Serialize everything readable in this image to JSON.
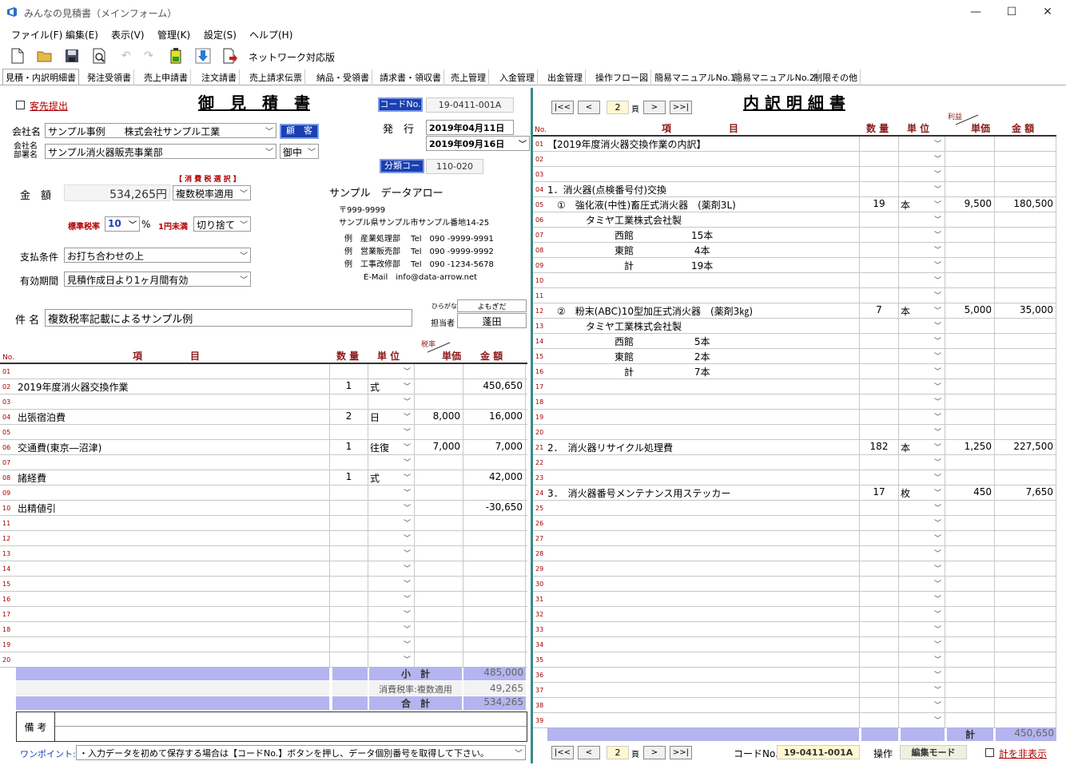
{
  "window": {
    "title": "みんなの見積書（メインフォーム）",
    "minimize": "—",
    "maximize": "☐",
    "close": "✕"
  },
  "menu": [
    "ファイル(F)",
    "編集(E)",
    "表示(V)",
    "管理(K)",
    "設定(S)",
    "ヘルプ(H)"
  ],
  "toolbar": {
    "network_label": "ネットワーク対応版"
  },
  "tabs": [
    "見積・内訳明細書",
    "発注受領書",
    "売上申請書",
    "注文請書",
    "売上請求伝票",
    "納品・受領書",
    "請求書・領収書",
    "売上管理",
    "入金管理",
    "出金管理",
    "操作フロー図",
    "簡易マニュアルNo.1",
    "簡易マニュアルNo.2",
    "制限その他"
  ],
  "left": {
    "send_label": "客先提出",
    "doc_title": "御　見　積　書",
    "code_btn": "コードNo.",
    "code_value": "19-0411-001A",
    "company_label": "会社名",
    "company_value": "サンプル事例　　株式会社サンプル工業",
    "customer_btn": "顧　客",
    "dept_label1": "会社名",
    "dept_label2": "部署名",
    "dept_value": "サンプル消火器販売事業部",
    "honorific": "御中",
    "issue_label": "発　行　日",
    "issue_date": "2019年04月11日",
    "date2": "2019年09月16日",
    "class_btn": "分類コード",
    "class_value": "110-020",
    "tax_select_label": "【 消 費 税 選 択 】",
    "tax_mode": "複数税率適用",
    "amount_label": "金　額",
    "amount_value": "534,265円",
    "std_rate_label": "標準税率",
    "std_rate": "10",
    "pct": "%",
    "rounding_label": "1円未満",
    "rounding": "切り捨て",
    "pay_label": "支払条件",
    "pay_value": "お打ち合わせの上",
    "valid_label": "有効期間",
    "valid_value": "見積作成日より1ヶ月間有効",
    "subject_label": "件 名",
    "subject_value": "複数税率記載によるサンプル例",
    "company_name": "サンプル　データアロー",
    "postal": "〒999-9999",
    "address": "サンプル県サンプル市サンプル番地14-25",
    "contacts": [
      "例　産業処理部　 Tel　090 -9999-9991",
      "例　営業販売部　 Tel　090 -9999-9992",
      "例　工事改修部　 Tel　090 -1234-5678"
    ],
    "email": "E-Mail　info@data-arrow.net",
    "hiragana_label": "ひらがな",
    "hiragana_value": "よもぎだ",
    "person_label": "担当者",
    "person_value": "蓬田",
    "col_no": "No.",
    "col_item": "項　　　　　目",
    "col_qty": "数 量",
    "col_unit": "単 位",
    "col_taxrate": "税率",
    "col_price": "単価",
    "col_amount": "金 額",
    "rows": [
      {
        "n": "01",
        "item": "",
        "qty": "",
        "unit": "",
        "price": "",
        "amount": ""
      },
      {
        "n": "02",
        "item": "2019年度消火器交換作業",
        "qty": "1",
        "unit": "式",
        "price": "",
        "amount": "450,650"
      },
      {
        "n": "03",
        "item": "",
        "qty": "",
        "unit": "",
        "price": "",
        "amount": ""
      },
      {
        "n": "04",
        "item": "出張宿泊費",
        "qty": "2",
        "unit": "日",
        "price": "8,000",
        "amount": "16,000"
      },
      {
        "n": "05",
        "item": "",
        "qty": "",
        "unit": "",
        "price": "",
        "amount": ""
      },
      {
        "n": "06",
        "item": "交通費(東京―沼津)",
        "qty": "1",
        "unit": "往復",
        "price": "7,000",
        "amount": "7,000"
      },
      {
        "n": "07",
        "item": "",
        "qty": "",
        "unit": "",
        "price": "",
        "amount": ""
      },
      {
        "n": "08",
        "item": "諸経費",
        "qty": "1",
        "unit": "式",
        "price": "",
        "amount": "42,000"
      },
      {
        "n": "09",
        "item": "",
        "qty": "",
        "unit": "",
        "price": "",
        "amount": ""
      },
      {
        "n": "10",
        "item": "出精値引",
        "qty": "",
        "unit": "",
        "price": "",
        "amount": "-30,650"
      },
      {
        "n": "11",
        "item": "",
        "qty": "",
        "unit": "",
        "price": "",
        "amount": ""
      },
      {
        "n": "12",
        "item": "",
        "qty": "",
        "unit": "",
        "price": "",
        "amount": ""
      },
      {
        "n": "13",
        "item": "",
        "qty": "",
        "unit": "",
        "price": "",
        "amount": ""
      },
      {
        "n": "14",
        "item": "",
        "qty": "",
        "unit": "",
        "price": "",
        "amount": ""
      },
      {
        "n": "15",
        "item": "",
        "qty": "",
        "unit": "",
        "price": "",
        "amount": ""
      },
      {
        "n": "16",
        "item": "",
        "qty": "",
        "unit": "",
        "price": "",
        "amount": ""
      },
      {
        "n": "17",
        "item": "",
        "qty": "",
        "unit": "",
        "price": "",
        "amount": ""
      },
      {
        "n": "18",
        "item": "",
        "qty": "",
        "unit": "",
        "price": "",
        "amount": ""
      },
      {
        "n": "19",
        "item": "",
        "qty": "",
        "unit": "",
        "price": "",
        "amount": ""
      },
      {
        "n": "20",
        "item": "",
        "qty": "",
        "unit": "",
        "price": "",
        "amount": ""
      }
    ],
    "subtotal_label": "小　計",
    "subtotal": "485,000",
    "tax_label": "消費税率:複数適用",
    "tax": "49,265",
    "total_label": "合　計",
    "total": "534,265",
    "remarks_label": "備 考",
    "remarks": "",
    "tip_label": "ワンポイント:",
    "tip": "・入力データを初めて保存する場合は【コードNo.】ボタンを押し、データ個別番号を取得して下さい。"
  },
  "right": {
    "page": "2",
    "page_suffix": "頁",
    "nav": [
      "|<<",
      "<",
      ">",
      ">>|"
    ],
    "doc_title": "内 訳 明 細 書",
    "col_no": "No.",
    "col_item": "項　　　　　　目",
    "col_qty": "数 量",
    "col_unit": "単 位",
    "col_profit": "利益",
    "col_price": "単価",
    "col_amount": "金 額",
    "rows": [
      {
        "n": "01",
        "item": "【2019年度消火器交換作業の内訳】",
        "qty": "",
        "unit": "",
        "price": "",
        "amount": ""
      },
      {
        "n": "02",
        "item": "",
        "qty": "",
        "unit": "",
        "price": "",
        "amount": ""
      },
      {
        "n": "03",
        "item": "",
        "qty": "",
        "unit": "",
        "price": "",
        "amount": ""
      },
      {
        "n": "04",
        "item": "1．消火器(点検番号付)交換",
        "qty": "",
        "unit": "",
        "price": "",
        "amount": ""
      },
      {
        "n": "05",
        "item": "　①　強化液(中性)畜圧式消火器　(薬剤3L)",
        "qty": "19",
        "unit": "本",
        "price": "9,500",
        "amount": "180,500"
      },
      {
        "n": "06",
        "item": "　　　　タミヤ工業株式会社製",
        "qty": "",
        "unit": "",
        "price": "",
        "amount": ""
      },
      {
        "n": "07",
        "item": "　　　　　　　西館　　　　　　15本",
        "qty": "",
        "unit": "",
        "price": "",
        "amount": ""
      },
      {
        "n": "08",
        "item": "　　　　　　　東館　　　　　　 4本",
        "qty": "",
        "unit": "",
        "price": "",
        "amount": ""
      },
      {
        "n": "09",
        "item": "　　　　　　　　計　　　　　　19本",
        "qty": "",
        "unit": "",
        "price": "",
        "amount": ""
      },
      {
        "n": "10",
        "item": "",
        "qty": "",
        "unit": "",
        "price": "",
        "amount": ""
      },
      {
        "n": "11",
        "item": "",
        "qty": "",
        "unit": "",
        "price": "",
        "amount": ""
      },
      {
        "n": "12",
        "item": "　②　粉末(ABC)10型加圧式消火器　(薬剤3㎏)",
        "qty": "7",
        "unit": "本",
        "price": "5,000",
        "amount": "35,000"
      },
      {
        "n": "13",
        "item": "　　　　タミヤ工業株式会社製",
        "qty": "",
        "unit": "",
        "price": "",
        "amount": ""
      },
      {
        "n": "14",
        "item": "　　　　　　　西館　　　　　　 5本",
        "qty": "",
        "unit": "",
        "price": "",
        "amount": ""
      },
      {
        "n": "15",
        "item": "　　　　　　　東館　　　　　　 2本",
        "qty": "",
        "unit": "",
        "price": "",
        "amount": ""
      },
      {
        "n": "16",
        "item": "　　　　　　　　計　　　　　　 7本",
        "qty": "",
        "unit": "",
        "price": "",
        "amount": ""
      },
      {
        "n": "17",
        "item": "",
        "qty": "",
        "unit": "",
        "price": "",
        "amount": ""
      },
      {
        "n": "18",
        "item": "",
        "qty": "",
        "unit": "",
        "price": "",
        "amount": ""
      },
      {
        "n": "19",
        "item": "",
        "qty": "",
        "unit": "",
        "price": "",
        "amount": ""
      },
      {
        "n": "20",
        "item": "",
        "qty": "",
        "unit": "",
        "price": "",
        "amount": ""
      },
      {
        "n": "21",
        "item": "2．　消火器リサイクル処理費",
        "qty": "182",
        "unit": "本",
        "price": "1,250",
        "amount": "227,500"
      },
      {
        "n": "22",
        "item": "",
        "qty": "",
        "unit": "",
        "price": "",
        "amount": ""
      },
      {
        "n": "23",
        "item": "",
        "qty": "",
        "unit": "",
        "price": "",
        "amount": ""
      },
      {
        "n": "24",
        "item": "3．　消火器番号メンテナンス用ステッカー",
        "qty": "17",
        "unit": "枚",
        "price": "450",
        "amount": "7,650"
      },
      {
        "n": "25",
        "item": "",
        "qty": "",
        "unit": "",
        "price": "",
        "amount": ""
      },
      {
        "n": "26",
        "item": "",
        "qty": "",
        "unit": "",
        "price": "",
        "amount": ""
      },
      {
        "n": "27",
        "item": "",
        "qty": "",
        "unit": "",
        "price": "",
        "amount": ""
      },
      {
        "n": "28",
        "item": "",
        "qty": "",
        "unit": "",
        "price": "",
        "amount": ""
      },
      {
        "n": "29",
        "item": "",
        "qty": "",
        "unit": "",
        "price": "",
        "amount": ""
      },
      {
        "n": "30",
        "item": "",
        "qty": "",
        "unit": "",
        "price": "",
        "amount": ""
      },
      {
        "n": "31",
        "item": "",
        "qty": "",
        "unit": "",
        "price": "",
        "amount": ""
      },
      {
        "n": "32",
        "item": "",
        "qty": "",
        "unit": "",
        "price": "",
        "amount": ""
      },
      {
        "n": "33",
        "item": "",
        "qty": "",
        "unit": "",
        "price": "",
        "amount": ""
      },
      {
        "n": "34",
        "item": "",
        "qty": "",
        "unit": "",
        "price": "",
        "amount": ""
      },
      {
        "n": "35",
        "item": "",
        "qty": "",
        "unit": "",
        "price": "",
        "amount": ""
      },
      {
        "n": "36",
        "item": "",
        "qty": "",
        "unit": "",
        "price": "",
        "amount": ""
      },
      {
        "n": "37",
        "item": "",
        "qty": "",
        "unit": "",
        "price": "",
        "amount": ""
      },
      {
        "n": "38",
        "item": "",
        "qty": "",
        "unit": "",
        "price": "",
        "amount": ""
      },
      {
        "n": "39",
        "item": "",
        "qty": "",
        "unit": "",
        "price": "",
        "amount": ""
      }
    ],
    "total_label": "計",
    "total": "450,650",
    "code_label": "コードNo.",
    "code_value": "19-0411-001A",
    "op_label": "操作",
    "mode_btn": "編集モード",
    "hide_total": "計を非表示"
  }
}
